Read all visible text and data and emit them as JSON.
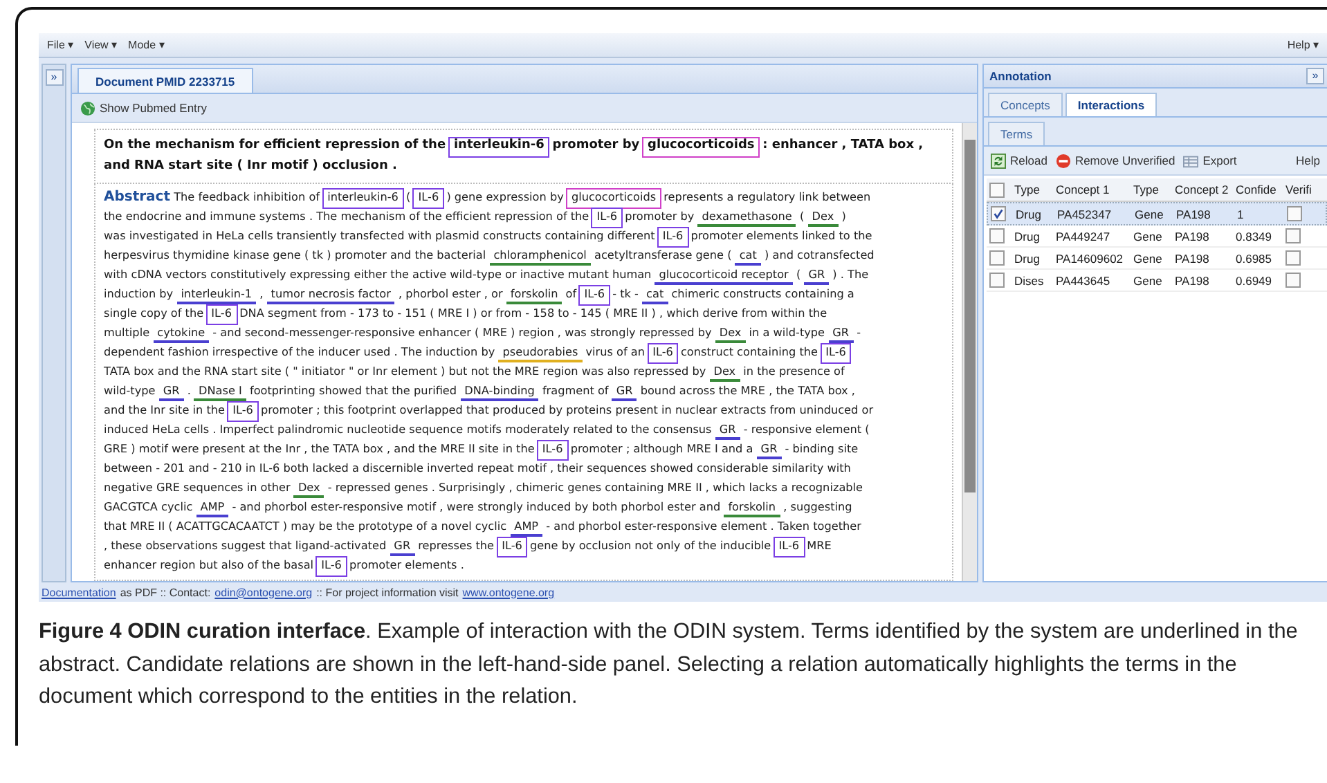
{
  "menu": {
    "left": [
      "File ▾",
      "View ▾",
      "Mode ▾"
    ],
    "right": "Help ▾"
  },
  "left_strip": {
    "button": "»"
  },
  "document": {
    "tab": "Document PMID 2233715",
    "toolbar": "Show Pubmed Entry",
    "title_lines": [
      [
        {
          "kind": "plain",
          "text": "On the mechanism for efficient repression of the"
        },
        {
          "kind": "highlight",
          "text": "interleukin-6",
          "color": "#7b3fe4"
        },
        {
          "kind": "plain",
          "text": "promoter by"
        },
        {
          "kind": "highlight",
          "text": "glucocorticoids",
          "color": "#d040c8"
        },
        {
          "kind": "plain",
          "text": ": enhancer , TATA box ,"
        }
      ],
      [
        {
          "kind": "plain",
          "text": "and RNA start site ( Inr motif ) occlusion ."
        }
      ]
    ],
    "abstract_label": "Abstract",
    "abstract_lines": [
      [
        {
          "kind": "plain",
          "text": "The feedback inhibition of"
        },
        {
          "kind": "highlight",
          "text": "interleukin-6",
          "color": "#7b3fe4"
        },
        {
          "kind": "plain",
          "text": "("
        },
        {
          "kind": "highlight",
          "text": "IL-6",
          "color": "#7b3fe4"
        },
        {
          "kind": "plain",
          "text": ") gene expression by"
        },
        {
          "kind": "highlight",
          "text": "glucocorticoids",
          "color": "#d040c8"
        },
        {
          "kind": "plain",
          "text": "represents a regulatory link between"
        }
      ],
      [
        {
          "kind": "plain",
          "text": "the endocrine and immune systems . The mechanism of the efficient repression of the"
        },
        {
          "kind": "highlight",
          "text": "IL-6",
          "color": "#7b3fe4"
        },
        {
          "kind": "plain",
          "text": "promoter by"
        },
        {
          "kind": "term",
          "text": "dexamethasone",
          "color": "#3a8a3a"
        },
        {
          "kind": "plain",
          "text": "("
        },
        {
          "kind": "term",
          "text": "Dex",
          "color": "#3a8a3a"
        },
        {
          "kind": "plain",
          "text": ")"
        }
      ],
      [
        {
          "kind": "plain",
          "text": "was investigated in HeLa cells transiently transfected with plasmid constructs containing different"
        },
        {
          "kind": "highlight",
          "text": "IL-6",
          "color": "#7b3fe4"
        },
        {
          "kind": "plain",
          "text": "promoter elements linked to the"
        }
      ],
      [
        {
          "kind": "plain",
          "text": "herpesvirus thymidine kinase gene ( tk ) promoter and the bacterial"
        },
        {
          "kind": "term",
          "text": "chloramphenicol",
          "color": "#3a8a3a"
        },
        {
          "kind": "plain",
          "text": "acetyltransferase gene ("
        },
        {
          "kind": "term",
          "text": "cat",
          "color": "#4a3fd0"
        },
        {
          "kind": "plain",
          "text": ") and cotransfected"
        }
      ],
      [
        {
          "kind": "plain",
          "text": "with cDNA vectors constitutively expressing either the active wild-type or inactive mutant human"
        },
        {
          "kind": "term",
          "text": "glucocorticoid receptor",
          "color": "#4a3fd0"
        },
        {
          "kind": "plain",
          "text": "("
        },
        {
          "kind": "term",
          "text": "GR",
          "color": "#4a3fd0"
        },
        {
          "kind": "plain",
          "text": ") . The"
        }
      ],
      [
        {
          "kind": "plain",
          "text": "induction by"
        },
        {
          "kind": "term",
          "text": "interleukin-1",
          "color": "#4a3fd0"
        },
        {
          "kind": "plain",
          "text": ","
        },
        {
          "kind": "term",
          "text": "tumor necrosis factor",
          "color": "#4a3fd0"
        },
        {
          "kind": "plain",
          "text": ", phorbol ester , or"
        },
        {
          "kind": "term",
          "text": "forskolin",
          "color": "#3a8a3a"
        },
        {
          "kind": "plain",
          "text": "of"
        },
        {
          "kind": "highlight",
          "text": "IL-6",
          "color": "#7b3fe4"
        },
        {
          "kind": "plain",
          "text": "- tk -"
        },
        {
          "kind": "term",
          "text": "cat",
          "color": "#4a3fd0"
        },
        {
          "kind": "plain",
          "text": "chimeric constructs containing a"
        }
      ],
      [
        {
          "kind": "plain",
          "text": "single copy of the"
        },
        {
          "kind": "highlight",
          "text": "IL-6",
          "color": "#7b3fe4"
        },
        {
          "kind": "plain",
          "text": "DNA segment from - 173 to - 151 ( MRE I ) or from - 158 to - 145 ( MRE II ) , which derive from within the"
        }
      ],
      [
        {
          "kind": "plain",
          "text": "multiple"
        },
        {
          "kind": "term",
          "text": "cytokine",
          "color": "#4a3fd0"
        },
        {
          "kind": "plain",
          "text": "- and second-messenger-responsive enhancer ( MRE ) region , was strongly repressed by"
        },
        {
          "kind": "term",
          "text": "Dex",
          "color": "#3a8a3a"
        },
        {
          "kind": "plain",
          "text": "in a wild-type"
        },
        {
          "kind": "term",
          "text": "GR",
          "color": "#4a3fd0"
        },
        {
          "kind": "plain",
          "text": "-"
        }
      ],
      [
        {
          "kind": "plain",
          "text": "dependent fashion irrespective of the inducer used . The induction by"
        },
        {
          "kind": "term",
          "text": "pseudorabies",
          "color": "#e0b020"
        },
        {
          "kind": "plain",
          "text": "virus of an"
        },
        {
          "kind": "highlight",
          "text": "IL-6",
          "color": "#7b3fe4"
        },
        {
          "kind": "plain",
          "text": "construct containing the"
        },
        {
          "kind": "highlight",
          "text": "IL-6",
          "color": "#7b3fe4"
        }
      ],
      [
        {
          "kind": "plain",
          "text": "TATA box and the RNA start site ( \" initiator \" or Inr element ) but not the MRE region was also repressed by"
        },
        {
          "kind": "term",
          "text": "Dex",
          "color": "#3a8a3a"
        },
        {
          "kind": "plain",
          "text": "in the presence of"
        }
      ],
      [
        {
          "kind": "plain",
          "text": "wild-type"
        },
        {
          "kind": "term",
          "text": "GR",
          "color": "#4a3fd0"
        },
        {
          "kind": "plain",
          "text": "."
        },
        {
          "kind": "term",
          "text": "DNase I",
          "color": "#3a8a3a"
        },
        {
          "kind": "plain",
          "text": "footprinting showed that the purified"
        },
        {
          "kind": "term",
          "text": "DNA-binding",
          "color": "#4a3fd0"
        },
        {
          "kind": "plain",
          "text": "fragment of"
        },
        {
          "kind": "term",
          "text": "GR",
          "color": "#4a3fd0"
        },
        {
          "kind": "plain",
          "text": "bound across the MRE , the TATA box ,"
        }
      ],
      [
        {
          "kind": "plain",
          "text": "and the Inr site in the"
        },
        {
          "kind": "highlight",
          "text": "IL-6",
          "color": "#7b3fe4"
        },
        {
          "kind": "plain",
          "text": "promoter ; this footprint overlapped that produced by proteins present in nuclear extracts from uninduced or"
        }
      ],
      [
        {
          "kind": "plain",
          "text": "induced HeLa cells . Imperfect palindromic nucleotide sequence motifs moderately related to the consensus"
        },
        {
          "kind": "term",
          "text": "GR",
          "color": "#4a3fd0"
        },
        {
          "kind": "plain",
          "text": "- responsive element ("
        }
      ],
      [
        {
          "kind": "plain",
          "text": "GRE ) motif were present at the Inr , the TATA box , and the MRE II site in the"
        },
        {
          "kind": "highlight",
          "text": "IL-6",
          "color": "#7b3fe4"
        },
        {
          "kind": "plain",
          "text": "promoter ; although MRE I and a"
        },
        {
          "kind": "term",
          "text": "GR",
          "color": "#4a3fd0"
        },
        {
          "kind": "plain",
          "text": "- binding site"
        }
      ],
      [
        {
          "kind": "plain",
          "text": "between - 201 and - 210 in IL-6 both lacked a discernible inverted repeat motif , their sequences showed considerable similarity with"
        }
      ],
      [
        {
          "kind": "plain",
          "text": "negative GRE sequences in other"
        },
        {
          "kind": "term",
          "text": "Dex",
          "color": "#3a8a3a"
        },
        {
          "kind": "plain",
          "text": "- repressed genes . Surprisingly , chimeric genes containing MRE II , which lacks a recognizable"
        }
      ],
      [
        {
          "kind": "plain",
          "text": "GACGTCA cyclic"
        },
        {
          "kind": "term",
          "text": "AMP",
          "color": "#4a3fd0"
        },
        {
          "kind": "plain",
          "text": "- and phorbol ester-responsive motif , were strongly induced by both phorbol ester and"
        },
        {
          "kind": "term",
          "text": "forskolin",
          "color": "#3a8a3a"
        },
        {
          "kind": "plain",
          "text": ", suggesting"
        }
      ],
      [
        {
          "kind": "plain",
          "text": "that MRE II ( ACATTGCACAATCT ) may be the prototype of a novel cyclic"
        },
        {
          "kind": "term",
          "text": "AMP",
          "color": "#4a3fd0"
        },
        {
          "kind": "plain",
          "text": "- and phorbol ester-responsive element . Taken together"
        }
      ],
      [
        {
          "kind": "plain",
          "text": ", these observations suggest that ligand-activated"
        },
        {
          "kind": "term",
          "text": "GR",
          "color": "#4a3fd0"
        },
        {
          "kind": "plain",
          "text": "represses the"
        },
        {
          "kind": "highlight",
          "text": "IL-6",
          "color": "#7b3fe4"
        },
        {
          "kind": "plain",
          "text": "gene by occlusion not only of the inducible"
        },
        {
          "kind": "highlight",
          "text": "IL-6",
          "color": "#7b3fe4"
        },
        {
          "kind": "plain",
          "text": "MRE"
        }
      ],
      [
        {
          "kind": "plain",
          "text": "enhancer region but also of the basal"
        },
        {
          "kind": "highlight",
          "text": "IL-6",
          "color": "#7b3fe4"
        },
        {
          "kind": "plain",
          "text": "promoter elements ."
        }
      ]
    ]
  },
  "annotation": {
    "title": "Annotation",
    "collapse": "»",
    "tabs": [
      {
        "label": "Concepts",
        "selected": false
      },
      {
        "label": "Interactions",
        "selected": true
      },
      {
        "label": "Terms",
        "selected": false
      }
    ],
    "toolbar": [
      "Reload",
      "Remove Unverified",
      "Export"
    ],
    "help": "Help",
    "all_checked": false,
    "columns": [
      "Type",
      "Concept 1",
      "Type",
      "Concept 2",
      "Confide",
      "Verifi"
    ],
    "rows": [
      {
        "checked": true,
        "selected": true,
        "cells": [
          "Drug",
          "PA452347",
          "Gene",
          "PA198",
          "1"
        ],
        "verified": false
      },
      {
        "checked": false,
        "selected": false,
        "cells": [
          "Drug",
          "PA449247",
          "Gene",
          "PA198",
          "0.8349"
        ],
        "verified": false
      },
      {
        "checked": false,
        "selected": false,
        "cells": [
          "Drug",
          "PA14609602",
          "Gene",
          "PA198",
          "0.6985"
        ],
        "verified": false
      },
      {
        "checked": false,
        "selected": false,
        "cells": [
          "Dises",
          "PA443645",
          "Gene",
          "PA198",
          "0.6949"
        ],
        "verified": false
      }
    ]
  },
  "footer": [
    {
      "kind": "link",
      "text": "Documentation"
    },
    {
      "kind": "plain",
      "text": "as PDF :: Contact:"
    },
    {
      "kind": "link",
      "text": "odin@ontogene.org"
    },
    {
      "kind": "plain",
      "text": "::  For project information visit"
    },
    {
      "kind": "link",
      "text": "www.ontogene.org"
    }
  ],
  "caption": "**Figure 4 ODIN curation interface**. Example of interaction with the ODIN system. Terms identified by the system are underlined in the abstract. Candidate relations are shown in the left-hand-side panel. Selecting a relation automatically highlights the terms in the document which correspond to the entities in the relation."
}
